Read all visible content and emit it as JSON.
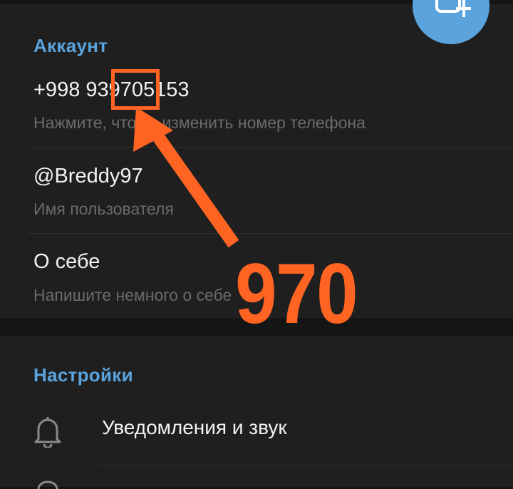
{
  "account": {
    "section_title": "Аккаунт",
    "phone": "+998 939705153",
    "phone_hint": "Нажмите, чтобы изменить номер телефона",
    "username": "@Breddy97",
    "username_hint": "Имя пользователя",
    "bio_title": "О себе",
    "bio_hint": "Напишите немного о себе"
  },
  "settings": {
    "section_title": "Настройки",
    "notifications_label": "Уведомления и звук"
  },
  "fab": {
    "icon": "add-photo-icon"
  },
  "annotation": {
    "highlight_number": "970",
    "color": "#ff6422"
  },
  "colors": {
    "accent": "#5aa3dc",
    "background": "#151515",
    "card": "#1f1f1f"
  }
}
